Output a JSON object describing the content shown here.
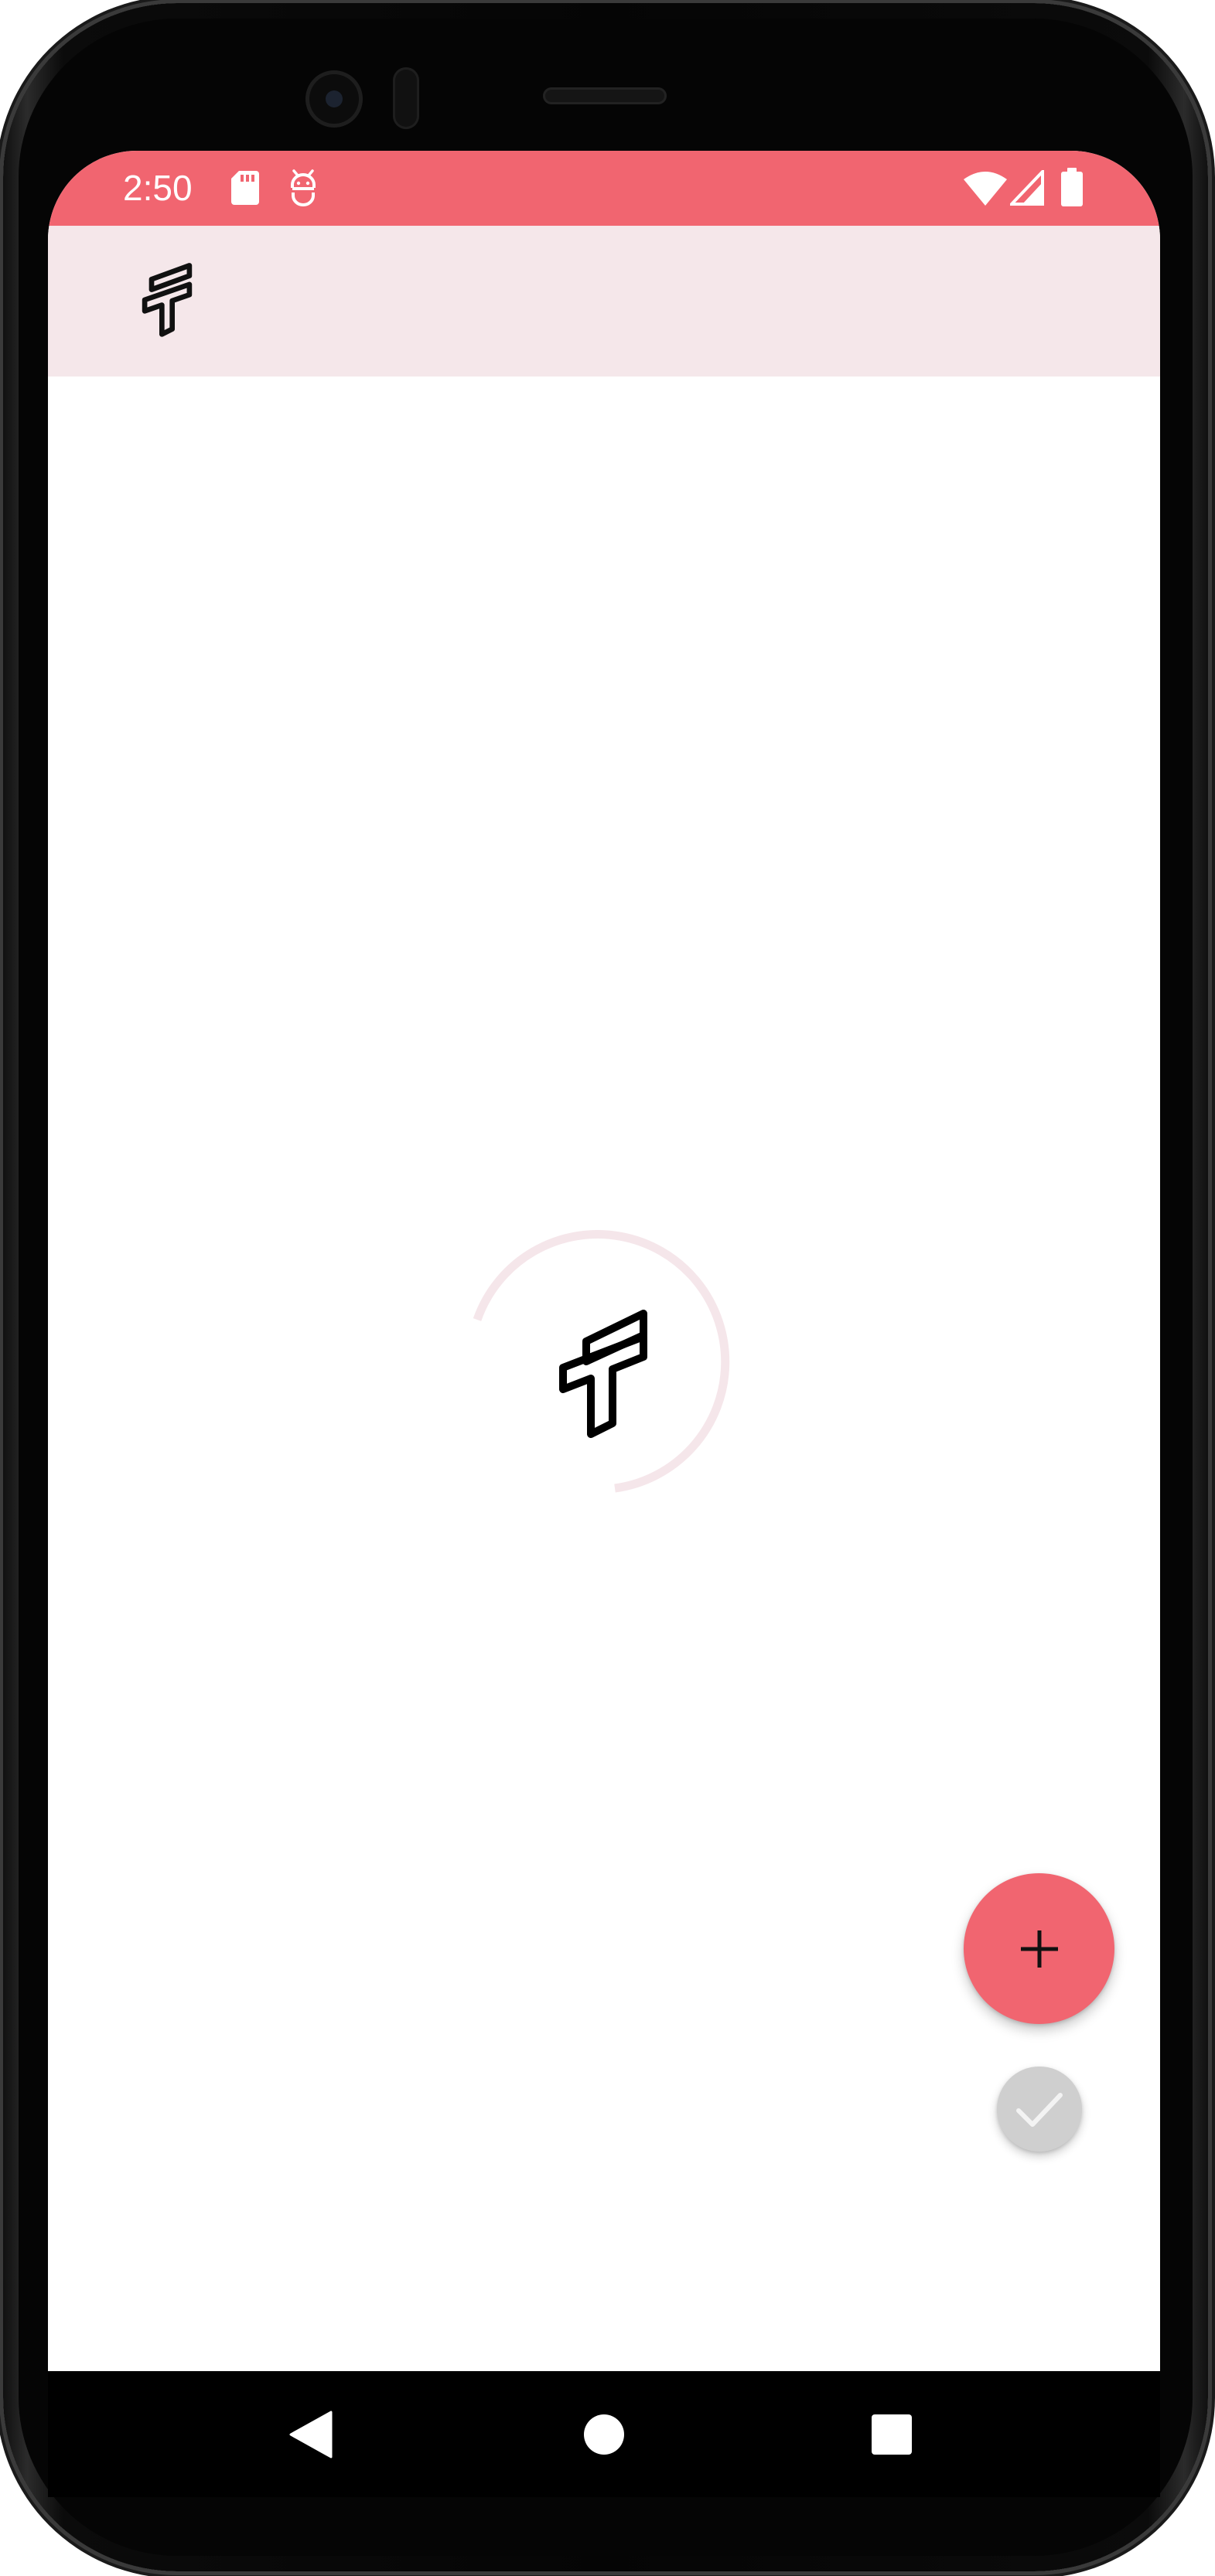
{
  "status_bar": {
    "time": "2:50",
    "left_icons": [
      "sd-card-icon",
      "android-debug-icon"
    ],
    "right_icons": [
      "wifi-icon",
      "cellular-signal-icon",
      "battery-icon"
    ],
    "color": "#f16570"
  },
  "app_bar": {
    "logo_icon": "app-logo-icon",
    "background": "#f5e7ea"
  },
  "content": {
    "loading_indicator": "circular-progress",
    "loading_logo_icon": "app-logo-icon"
  },
  "fabs": {
    "add_icon": "plus-icon",
    "add_color": "#f16570",
    "check_icon": "check-icon",
    "check_color": "#cfcfcf"
  },
  "nav_bar": {
    "buttons": [
      "back-icon",
      "home-icon",
      "recents-icon"
    ]
  }
}
